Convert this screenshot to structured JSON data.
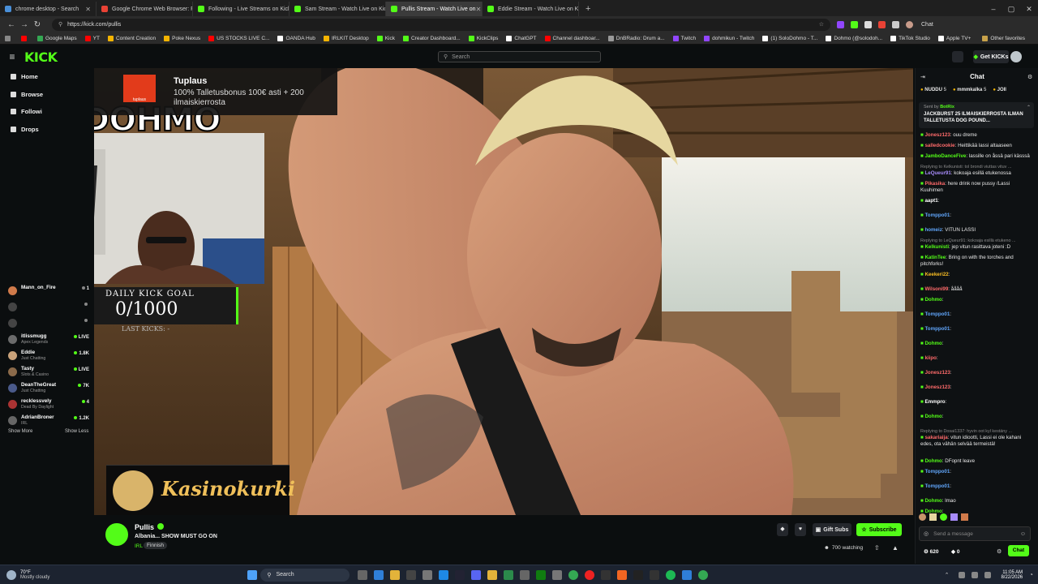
{
  "browser": {
    "tabs": [
      {
        "title": "chrome desktop - Search",
        "color": "#4a90d9",
        "active": false
      },
      {
        "title": "Google Chrome Web Browser: Fir",
        "color": "#e94235",
        "active": false
      },
      {
        "title": "Following - Live Streams on Kick",
        "color": "#53fc18",
        "active": false
      },
      {
        "title": "Sam Stream - Watch Live on Kick",
        "color": "#53fc18",
        "active": false
      },
      {
        "title": "Pullis Stream - Watch Live on",
        "color": "#53fc18",
        "active": true
      },
      {
        "title": "Eddie Stream - Watch Live on Kick",
        "color": "#53fc18",
        "active": false
      }
    ],
    "new_tab": "+",
    "url": "https://kick.com/pullis",
    "bookmarks": [
      {
        "label": "Google Maps",
        "color": "#34a853"
      },
      {
        "label": "YT",
        "color": "#ff0000"
      },
      {
        "label": "Content Creation",
        "color": "#f4b400"
      },
      {
        "label": "Poke Nexus",
        "color": "#f4b400"
      },
      {
        "label": "US STOCKS LIVE C...",
        "color": "#ff0000"
      },
      {
        "label": "OANDA Hub",
        "color": "#ffffff"
      },
      {
        "label": "IRLKIT Desktop",
        "color": "#f4b400"
      },
      {
        "label": "Kick",
        "color": "#53fc18"
      },
      {
        "label": "Creator Dashboard...",
        "color": "#53fc18"
      },
      {
        "label": "KickClips",
        "color": "#53fc18"
      },
      {
        "label": "ChatGPT",
        "color": "#ffffff"
      },
      {
        "label": "Channel dashboar...",
        "color": "#ff0000"
      },
      {
        "label": "DnBRadio: Drum a...",
        "color": "#999999"
      },
      {
        "label": "Twitch",
        "color": "#9146ff"
      },
      {
        "label": "dohmikun - Twitch",
        "color": "#9146ff"
      },
      {
        "label": "(1) SoloDohmo - T...",
        "color": "#ffffff"
      },
      {
        "label": "Dohmo (@solodoh...",
        "color": "#ffffff"
      },
      {
        "label": "TikTok Studio",
        "color": "#ffffff"
      },
      {
        "label": "Apple TV+",
        "color": "#ffffff"
      }
    ],
    "other_favorites": "Other favorites",
    "chat_label": "Chat"
  },
  "kick": {
    "logo": "KICK",
    "search_placeholder": "Search",
    "get_kicks": "Get KICKs",
    "nav": {
      "home": "Home",
      "browse": "Browse",
      "following": "Followi",
      "drops": "Drops"
    },
    "channels": [
      {
        "name": "Mann_on_Fire",
        "category": "",
        "viewers": "1",
        "live": false,
        "color": "#d07a4a"
      },
      {
        "name": "",
        "category": "",
        "viewers": "",
        "live": false,
        "color": "#444"
      },
      {
        "name": "",
        "category": "",
        "viewers": "",
        "live": false,
        "color": "#444"
      },
      {
        "name": "itlissmugg",
        "category": "Apex Legends",
        "viewers": "LIVE",
        "live": true,
        "color": "#6b6b6b"
      },
      {
        "name": "Eddie",
        "category": "Just Chatting",
        "viewers": "1.8K",
        "live": true,
        "color": "#c9a27a"
      },
      {
        "name": "Tasty",
        "category": "Slots & Casino",
        "viewers": "LIVE",
        "live": true,
        "color": "#8b6a4a"
      },
      {
        "name": "DeanTheGreat",
        "category": "Just Chatting",
        "viewers": "7K",
        "live": true,
        "color": "#4a5a8a"
      },
      {
        "name": "recklessvely",
        "category": "Dead By Daylight",
        "viewers": "4",
        "live": true,
        "color": "#a33"
      },
      {
        "name": "AdrianBroner",
        "category": "IRL",
        "viewers": "1.2K",
        "live": true,
        "color": "#666"
      }
    ],
    "show_more": "Show More",
    "show_less": "Show Less"
  },
  "stream": {
    "overlay_brand": "DOHMO",
    "ad_title": "Tuplaus",
    "ad_text": "100% Talletusbonus 100€ asti + 200",
    "ad_text2": "ilmaiskierrosta",
    "ad_logo": "tuplaus",
    "goal_title": "DAILY KICK GOAL",
    "goal_value": "0/1000",
    "goal_progress": 0,
    "goal_sub": "LAST KICKS: -",
    "sponsor": "Kasinokurki"
  },
  "channel": {
    "name": "Pullis",
    "title": "Albania... SHOW MUST GO ON",
    "category": "IRL",
    "tag": "Finnish",
    "watching": "700 watching",
    "gift_subs": "Gift Subs",
    "subscribe": "Subscribe"
  },
  "chat": {
    "header": "Chat",
    "top_gifters": [
      {
        "name": "NUDDU",
        "count": "5"
      },
      {
        "name": "mmmkalka",
        "count": "5"
      },
      {
        "name": "JOII",
        "count": ""
      }
    ],
    "pinned_by": "Sent by",
    "pinned_user": "BotRix",
    "pinned_text": "JACKBURST 25 ILMAISKIERROSTA ILMAN TALLETUSTA DOG POUND...",
    "messages": [
      {
        "reply": "",
        "user": "Jonesz123",
        "color": "#ff6b6b",
        "text": "ouu dreme"
      },
      {
        "reply": "",
        "user": "salledcookie",
        "color": "#ff6b6b",
        "text": "Heittikää lassi altaaseen"
      },
      {
        "reply": "",
        "user": "JamboDanceFive",
        "color": "#53fc18",
        "text": "lassille on åssä pari kässsä"
      },
      {
        "reply": "Replying to Kelkunisti: tol brondi viuttas vituv ...",
        "user": "LeQueur91",
        "color": "#a78bfa",
        "text": "kokoaja esillä etukenossa"
      },
      {
        "reply": "",
        "user": "Pikasika",
        "color": "#ff6b6b",
        "text": "here drink now pussy /Lassi Kuuhimen"
      },
      {
        "reply": "",
        "user": "aapt1",
        "color": "#ffffff",
        "text": ""
      },
      {
        "reply": "",
        "user": "Tomppo01",
        "color": "#60a5fa",
        "text": ""
      },
      {
        "reply": "",
        "user": "homeiz",
        "color": "#60a5fa",
        "text": "VITUN LASSI"
      },
      {
        "reply": "Replying to LeQueur91: kokoaja esillä etukeno ...",
        "user": "Kelkunisti",
        "color": "#53fc18",
        "text": "jep vitun rasittava joteni :D"
      },
      {
        "reply": "",
        "user": "KatinTee",
        "color": "#53fc18",
        "text": "Bring on with the torches and pitchforks!"
      },
      {
        "reply": "",
        "user": "Keekeri22",
        "color": "#fbbf24",
        "text": ""
      },
      {
        "reply": "",
        "user": "Wilsoni99",
        "color": "#ff6b6b",
        "text": "åååå"
      },
      {
        "reply": "",
        "user": "Dohmo",
        "color": "#53fc18",
        "text": ""
      },
      {
        "reply": "",
        "user": "Tomppo01",
        "color": "#60a5fa",
        "text": ""
      },
      {
        "reply": "",
        "user": "Tomppo01",
        "color": "#60a5fa",
        "text": ""
      },
      {
        "reply": "",
        "user": "Dohmo",
        "color": "#53fc18",
        "text": ""
      },
      {
        "reply": "",
        "user": "kiipo",
        "color": "#ff6b6b",
        "text": ""
      },
      {
        "reply": "",
        "user": "Jonesz123",
        "color": "#ff6b6b",
        "text": ""
      },
      {
        "reply": "",
        "user": "Jonesz123",
        "color": "#ff6b6b",
        "text": ""
      },
      {
        "reply": "",
        "user": "Emmpro",
        "color": "#ffffff",
        "text": ""
      },
      {
        "reply": "",
        "user": "Dohmo",
        "color": "#53fc18",
        "text": ""
      },
      {
        "reply": "Replying to Dosai1337: hyvin oot kyl kestäny ...",
        "user": "sakariaija",
        "color": "#ff6b6b",
        "text": "vitun idiootti, Lassi ei ole kahani edes, ota vähän selvää termeistä!"
      },
      {
        "reply": "",
        "user": "Dohmo",
        "color": "#53fc18",
        "text": "DFopnt leave"
      },
      {
        "reply": "",
        "user": "Tomppo01",
        "color": "#60a5fa",
        "text": ""
      },
      {
        "reply": "",
        "user": "Tomppo01",
        "color": "#60a5fa",
        "text": ""
      },
      {
        "reply": "",
        "user": "Dohmo",
        "color": "#53fc18",
        "text": "lmao"
      },
      {
        "reply": "",
        "user": "Dohmo",
        "color": "#53fc18",
        "text": ""
      }
    ],
    "input_placeholder": "Send a message",
    "points": "620",
    "zero": "0",
    "send": "Chat"
  },
  "taskbar": {
    "weather_temp": "70°F",
    "weather_desc": "Mostly cloudy",
    "search": "Search",
    "time": "11:05 AM",
    "date": "8/22/2026"
  }
}
